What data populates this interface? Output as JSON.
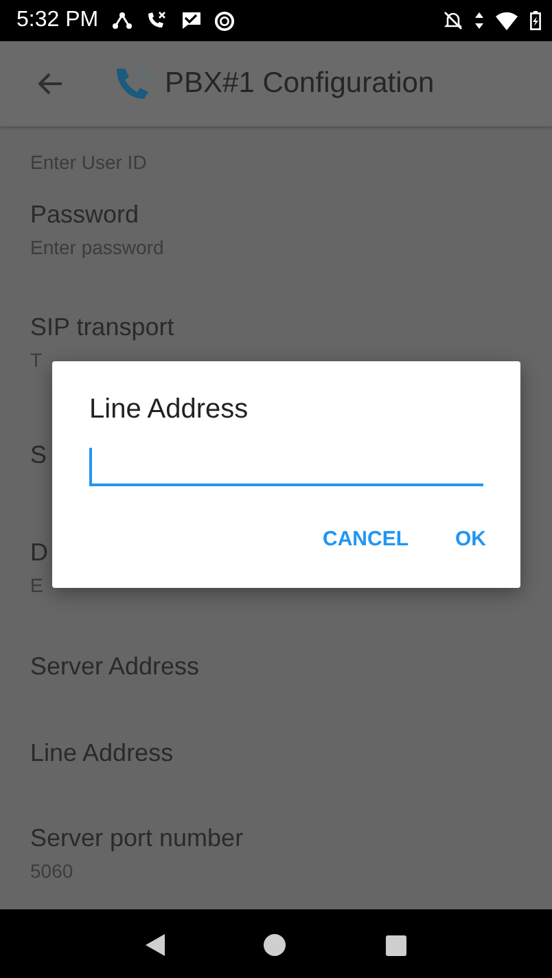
{
  "status_bar": {
    "time": "5:32 PM"
  },
  "app_bar": {
    "title": "PBX#1 Configuration"
  },
  "settings": [
    {
      "subtitle": "Enter User ID",
      "kind": "top"
    },
    {
      "title": "Password",
      "subtitle": "Enter password",
      "kind": "two"
    },
    {
      "title": "SIP transport",
      "subtitle": "T",
      "kind": "two"
    },
    {
      "title": "S",
      "kind": "two"
    },
    {
      "title": "D",
      "subtitle": "E",
      "kind": "two"
    },
    {
      "title": "Server Address",
      "kind": "one"
    },
    {
      "title": "Line Address",
      "kind": "one"
    },
    {
      "title": "Server port number",
      "subtitle": "5060",
      "kind": "two"
    }
  ],
  "dialog": {
    "title": "Line Address",
    "buttons": [
      "CANCEL",
      "OK"
    ]
  }
}
